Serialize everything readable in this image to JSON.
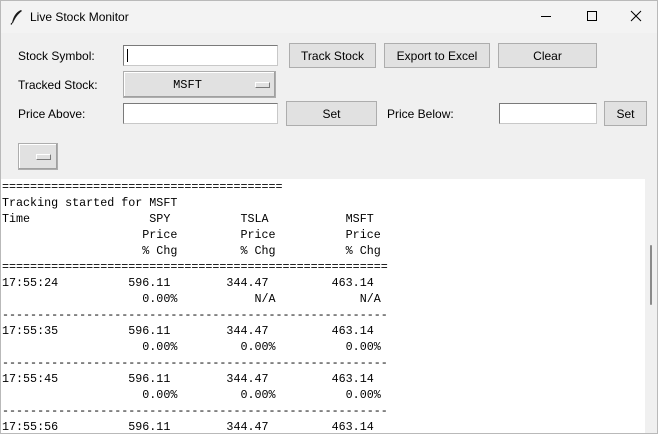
{
  "window": {
    "title": "Live Stock Monitor",
    "minimize_icon": "minimize-icon",
    "maximize_icon": "maximize-icon",
    "close_icon": "close-icon",
    "app_icon": "feather-icon"
  },
  "controls": {
    "symbol_label": "Stock Symbol:",
    "symbol_value": "",
    "track_button": "Track Stock",
    "export_button": "Export to Excel",
    "clear_button": "Clear",
    "tracked_label": "Tracked Stock:",
    "tracked_value": "MSFT",
    "price_above_label": "Price Above:",
    "price_above_value": "",
    "set_above_button": "Set",
    "price_below_label": "Price Below:",
    "price_below_value": "",
    "set_below_button": "Set",
    "extra_menu_value": ""
  },
  "output": {
    "lines": [
      "========================================",
      "Tracking started for MSFT",
      "Time                 SPY          TSLA           MSFT",
      "                    Price         Price          Price",
      "                    % Chg         % Chg          % Chg",
      "=======================================================",
      "17:55:24          596.11        344.47         463.14",
      "                    0.00%           N/A            N/A",
      "-------------------------------------------------------",
      "17:55:35          596.11        344.47         463.14",
      "                    0.00%         0.00%          0.00%",
      "-------------------------------------------------------",
      "17:55:45          596.11        344.47         463.14",
      "                    0.00%         0.00%          0.00%",
      "-------------------------------------------------------",
      "17:55:56          596.11        344.47         463.14"
    ]
  }
}
